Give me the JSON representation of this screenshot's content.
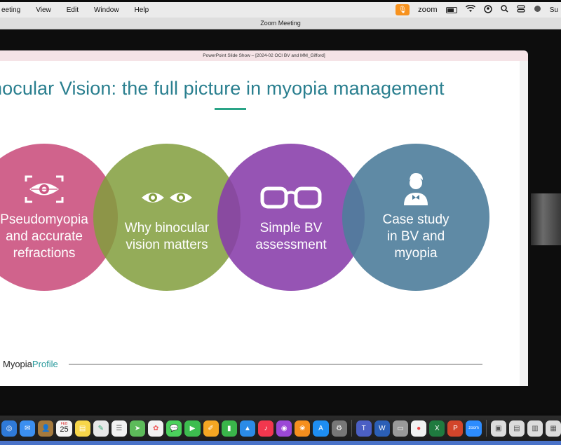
{
  "menubar": {
    "items": [
      "eeting",
      "View",
      "Edit",
      "Window",
      "Help"
    ],
    "app_name": "zoom",
    "user_trunc": "Su"
  },
  "window": {
    "title": "Zoom Meeting"
  },
  "powerpoint": {
    "title": "PowerPoint Slide Show – [2024-02 OCI BV and MM_Gifford]"
  },
  "slide": {
    "title": "nocular Vision: the full picture in myopia management",
    "circles": [
      {
        "lines": [
          "Pseudomyopia",
          "and accurate",
          "refractions"
        ],
        "icon": "eye-scan-icon",
        "color": "#cc5682"
      },
      {
        "lines": [
          "Why binocular",
          "vision matters"
        ],
        "icon": "eyes-icon",
        "color": "#819d3c"
      },
      {
        "lines": [
          "Simple BV",
          "assessment"
        ],
        "icon": "glasses-icon",
        "color": "#883caa"
      },
      {
        "lines": [
          "Case study",
          "in BV and",
          "myopia"
        ],
        "icon": "person-icon",
        "color": "#4e7d9b"
      }
    ],
    "brand": {
      "part1": "Myopia",
      "part2": "Profile"
    },
    "accent_color": "#2a7f8f"
  },
  "dock": {
    "calendar_day": "25",
    "calendar_month": "FEB"
  }
}
